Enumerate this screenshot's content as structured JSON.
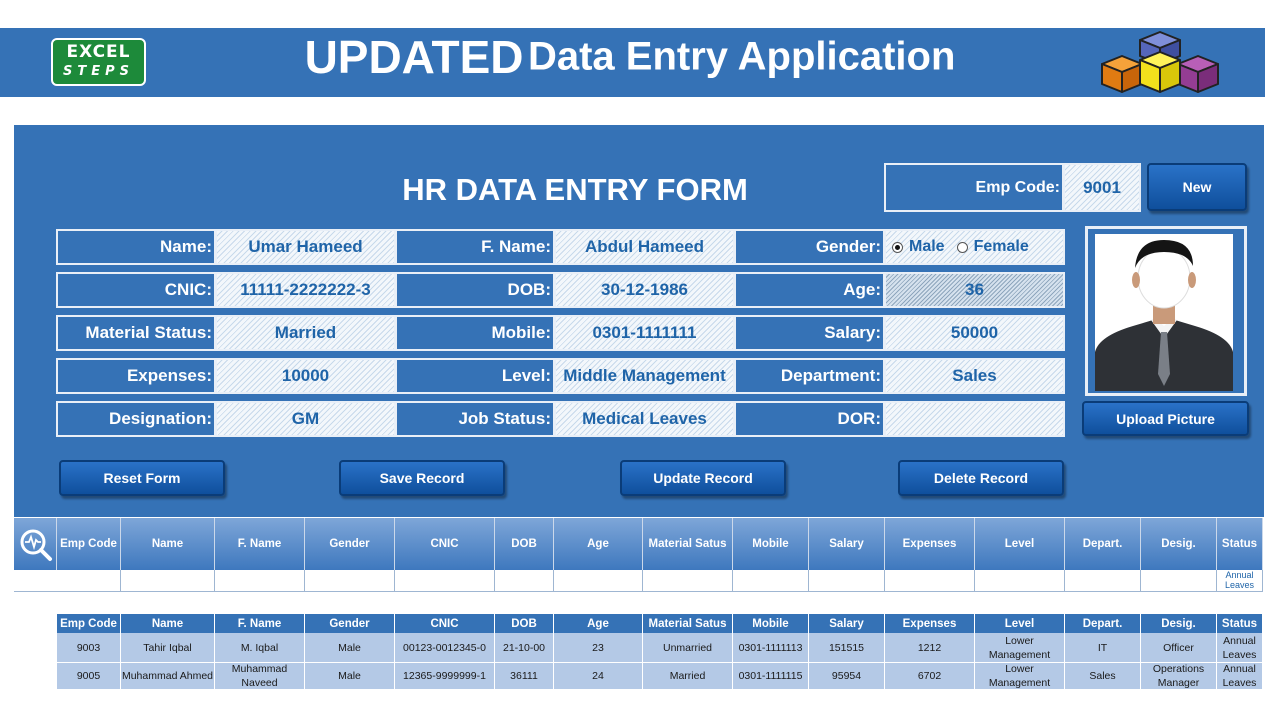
{
  "header": {
    "logo_line1": "EXCEL",
    "logo_line2": "STEPS",
    "title_big": "UPDATED",
    "title_rest": "Data Entry Application"
  },
  "form": {
    "title": "HR DATA ENTRY FORM",
    "emp_code_label": "Emp Code:",
    "emp_code_value": "9001",
    "new_button": "New",
    "fields": {
      "name_label": "Name:",
      "name_value": "Umar Hameed",
      "fname_label": "F. Name:",
      "fname_value": "Abdul Hameed",
      "gender_label": "Gender:",
      "gender_male": "Male",
      "gender_female": "Female",
      "gender_selected": "Male",
      "cnic_label": "CNIC:",
      "cnic_value": "11111-2222222-3",
      "dob_label": "DOB:",
      "dob_value": "30-12-1986",
      "age_label": "Age:",
      "age_value": "36",
      "marital_label": "Material Status:",
      "marital_value": "Married",
      "mobile_label": "Mobile:",
      "mobile_value": "0301-1111111",
      "salary_label": "Salary:",
      "salary_value": "50000",
      "expenses_label": "Expenses:",
      "expenses_value": "10000",
      "level_label": "Level:",
      "level_value": "Middle Management",
      "department_label": "Department:",
      "department_value": "Sales",
      "designation_label": "Designation:",
      "designation_value": "GM",
      "jobstatus_label": "Job Status:",
      "jobstatus_value": "Medical Leaves",
      "dor_label": "DOR:",
      "dor_value": ""
    },
    "upload_button": "Upload Picture",
    "actions": {
      "reset": "Reset Form",
      "save": "Save Record",
      "update": "Update Record",
      "delete": "Delete Record"
    }
  },
  "search_table": {
    "headers": [
      "Emp Code",
      "Name",
      "F. Name",
      "Gender",
      "CNIC",
      "DOB",
      "Age",
      "Material Satus",
      "Mobile",
      "Salary",
      "Expenses",
      "Level",
      "Depart.",
      "Desig.",
      "Status"
    ],
    "row": [
      "",
      "",
      "",
      "",
      "",
      "",
      "",
      "",
      "",
      "",
      "",
      "",
      "",
      "",
      "Annual Leaves"
    ]
  },
  "data_table": {
    "headers": [
      "Emp Code",
      "Name",
      "F. Name",
      "Gender",
      "CNIC",
      "DOB",
      "Age",
      "Material Satus",
      "Mobile",
      "Salary",
      "Expenses",
      "Level",
      "Depart.",
      "Desig.",
      "Status"
    ],
    "rows": [
      [
        "9003",
        "Tahir Iqbal",
        "M. Iqbal",
        "Male",
        "00123-0012345-0",
        "21-10-00",
        "23",
        "Unmarried",
        "0301-1111113",
        "151515",
        "1212",
        "Lower Management",
        "IT",
        "Officer",
        "Annual Leaves"
      ],
      [
        "9005",
        "Muhammad Ahmed",
        "Muhammad Naveed",
        "Male",
        "12365-9999999-1",
        "36111",
        "24",
        "Married",
        "0301-1111115",
        "95954",
        "6702",
        "Lower Management",
        "Sales",
        "Operations Manager",
        "Annual Leaves"
      ]
    ]
  },
  "colors": {
    "primary_blue": "#3572b6",
    "value_text": "#1f64a8",
    "button_blue": "#1561b8",
    "row_fill": "#b4c9e6"
  },
  "icons": {
    "search": "magnifier-pulse-icon",
    "logo": "excel-steps-logo",
    "cubes": "cubes-icon",
    "photo": "employee-photo"
  }
}
